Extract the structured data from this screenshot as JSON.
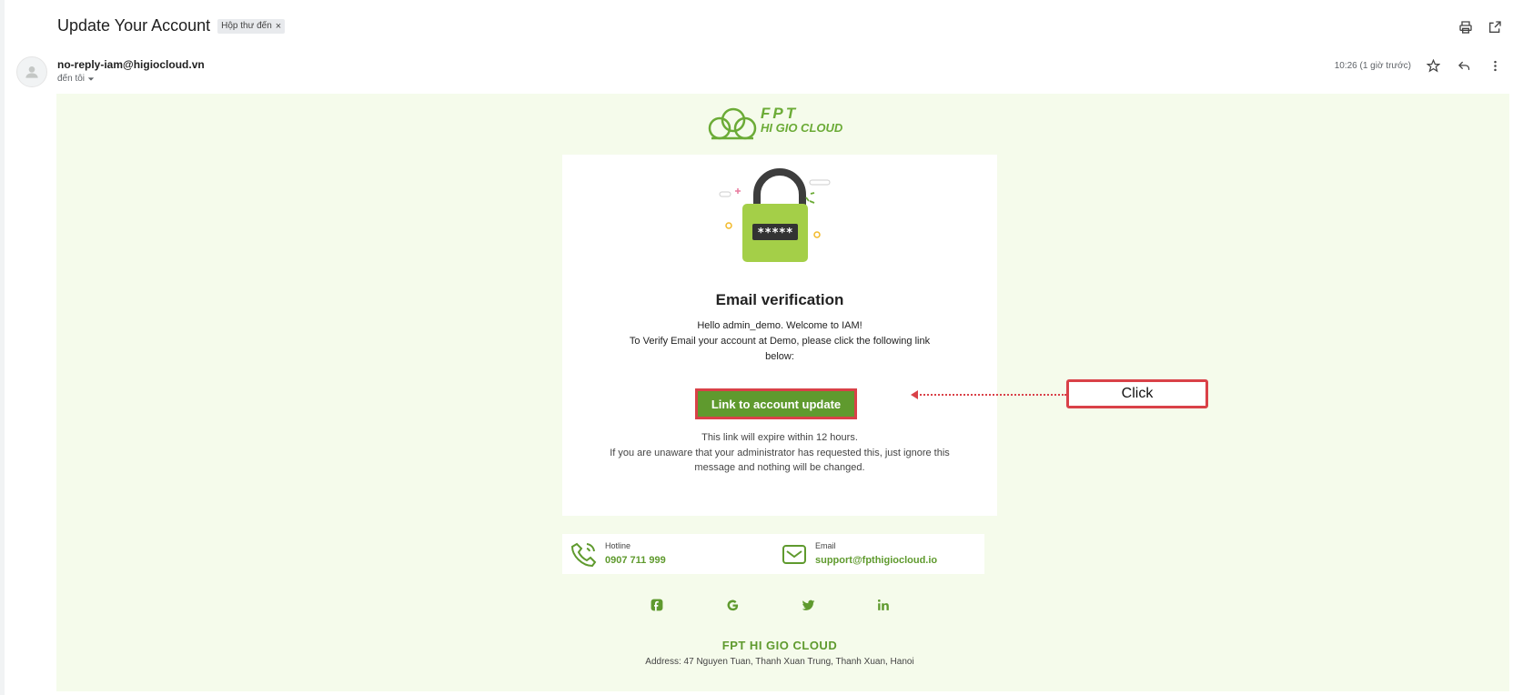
{
  "email": {
    "subject": "Update Your Account",
    "label": "Hộp thư đến",
    "label_close": "×",
    "sender": "no-reply-iam@higiocloud.vn",
    "to_text": "đến tôi",
    "time": "10:26 (1 giờ trước)"
  },
  "brand": {
    "logo_line1": "FPT",
    "logo_line2": "HI GIO CLOUD",
    "accent": "#5f9a2e"
  },
  "card": {
    "title": "Email verification",
    "greeting": "Hello admin_demo. Welcome to IAM!",
    "instruction": "To Verify Email your account at Demo, please click the following link below:",
    "button_label": "Link to account update",
    "expire_line": "This link will expire within 12 hours.",
    "ignore_line": "If you are unaware that your administrator has requested this, just ignore this message and nothing will be changed.",
    "password_mask": "*****"
  },
  "annotation": {
    "label": "Click",
    "color": "#d94148"
  },
  "contacts": {
    "hotline_label": "Hotline",
    "hotline_value": "0907 711 999",
    "email_label": "Email",
    "email_value": "support@fpthigiocloud.io"
  },
  "social": [
    "facebook-icon",
    "google-icon",
    "twitter-icon",
    "linkedin-icon"
  ],
  "footer": {
    "brand": "FPT HI GIO CLOUD",
    "address": "Address: 47 Nguyen Tuan, Thanh Xuan Trung, Thanh Xuan, Hanoi"
  }
}
